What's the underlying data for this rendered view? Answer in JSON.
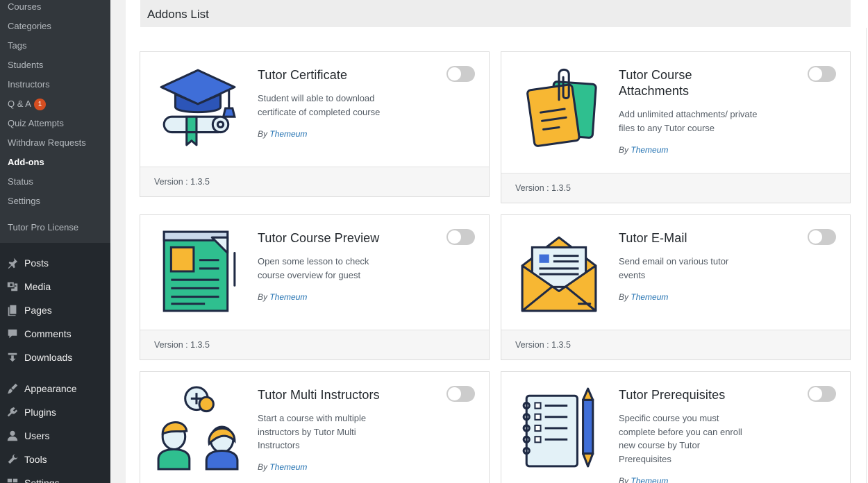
{
  "sidebar": {
    "submenu": [
      {
        "label": "Courses"
      },
      {
        "label": "Categories"
      },
      {
        "label": "Tags"
      },
      {
        "label": "Students"
      },
      {
        "label": "Instructors"
      },
      {
        "label": "Q & A",
        "badge": "1"
      },
      {
        "label": "Quiz Attempts"
      },
      {
        "label": "Withdraw Requests"
      },
      {
        "label": "Add-ons",
        "current": true
      },
      {
        "label": "Status"
      },
      {
        "label": "Settings"
      },
      {
        "label": "Tutor Pro License"
      }
    ],
    "menu": [
      {
        "label": "Posts",
        "icon": "pin-icon"
      },
      {
        "label": "Media",
        "icon": "media-icon"
      },
      {
        "label": "Pages",
        "icon": "pages-icon"
      },
      {
        "label": "Comments",
        "icon": "comments-icon"
      },
      {
        "label": "Downloads",
        "icon": "downloads-icon"
      },
      {
        "label": "Appearance",
        "icon": "appearance-icon"
      },
      {
        "label": "Plugins",
        "icon": "plugins-icon"
      },
      {
        "label": "Users",
        "icon": "users-icon"
      },
      {
        "label": "Tools",
        "icon": "tools-icon"
      },
      {
        "label": "Settings",
        "icon": "settings-icon"
      }
    ]
  },
  "page": {
    "title": "Addons List"
  },
  "addons": [
    {
      "title": "Tutor Certificate",
      "description": "Student will able to download certificate of completed course",
      "by": "By",
      "author": "Themeum",
      "version": "Version : 1.3.5",
      "icon": "graduation-cap-icon"
    },
    {
      "title": "Tutor Course Attachments",
      "description": "Add unlimited attachments/ private files to any Tutor course",
      "by": "By",
      "author": "Themeum",
      "version": "Version : 1.3.5",
      "icon": "sticky-note-icon"
    },
    {
      "title": "Tutor Course Preview",
      "description": "Open some lesson to check course overview for guest",
      "by": "By",
      "author": "Themeum",
      "version": "Version : 1.3.5",
      "icon": "document-preview-icon"
    },
    {
      "title": "Tutor E-Mail",
      "description": "Send email on various tutor events",
      "by": "By",
      "author": "Themeum",
      "version": "Version : 1.3.5",
      "icon": "envelope-icon"
    },
    {
      "title": "Tutor Multi Instructors",
      "description": "Start a course with multiple instructors by Tutor Multi Instructors",
      "by": "By",
      "author": "Themeum",
      "version": "",
      "icon": "multi-instructors-icon"
    },
    {
      "title": "Tutor Prerequisites",
      "description": "Specific course you must complete before you can enroll new course by Tutor Prerequisites",
      "by": "By",
      "author": "Themeum",
      "version": "",
      "icon": "checklist-icon"
    }
  ],
  "colors": {
    "sidebar_bg": "#23282d",
    "submenu_bg": "#32373c",
    "badge": "#d54e21",
    "link": "#2271b1",
    "toggle_off": "#cccccc"
  }
}
